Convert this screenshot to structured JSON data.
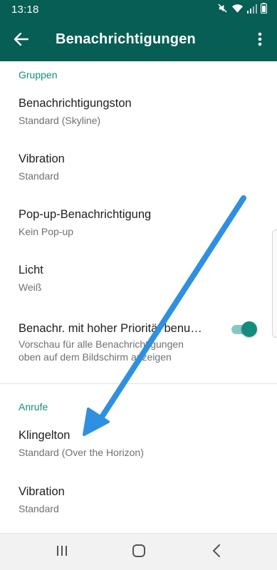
{
  "status_bar": {
    "time": "13:18",
    "icons": [
      "mute-icon",
      "wifi-icon",
      "signal-icon",
      "battery-icon"
    ]
  },
  "toolbar": {
    "title": "Benachrichtigungen",
    "back_icon": "arrow-left-icon",
    "more_icon": "more-vert-icon"
  },
  "sections": {
    "gruppen": {
      "header": "Gruppen",
      "items": [
        {
          "title": "Benachrichtigungston",
          "summary": "Standard (Skyline)"
        },
        {
          "title": "Vibration",
          "summary": "Standard"
        },
        {
          "title": "Pop-up-Benachrichtigung",
          "summary": "Kein Pop-up"
        },
        {
          "title": "Licht",
          "summary": "Weiß"
        },
        {
          "title": "Benachr. mit hoher Priorität benu…",
          "summary_line1": "Vorschau für alle Benachrichtigungen",
          "summary_line2": "oben auf dem Bildschirm anzeigen",
          "toggle_on": true
        }
      ]
    },
    "anrufe": {
      "header": "Anrufe",
      "items": [
        {
          "title": "Klingelton",
          "summary": "Standard (Over the Horizon)"
        },
        {
          "title": "Vibration",
          "summary": "Standard"
        }
      ]
    }
  },
  "nav_bar": {
    "icons": [
      "recents-icon",
      "home-icon",
      "back-icon"
    ]
  },
  "colors": {
    "primary": "#075e54",
    "accent": "#128c7e",
    "annotation_arrow": "#2f8fe0"
  }
}
